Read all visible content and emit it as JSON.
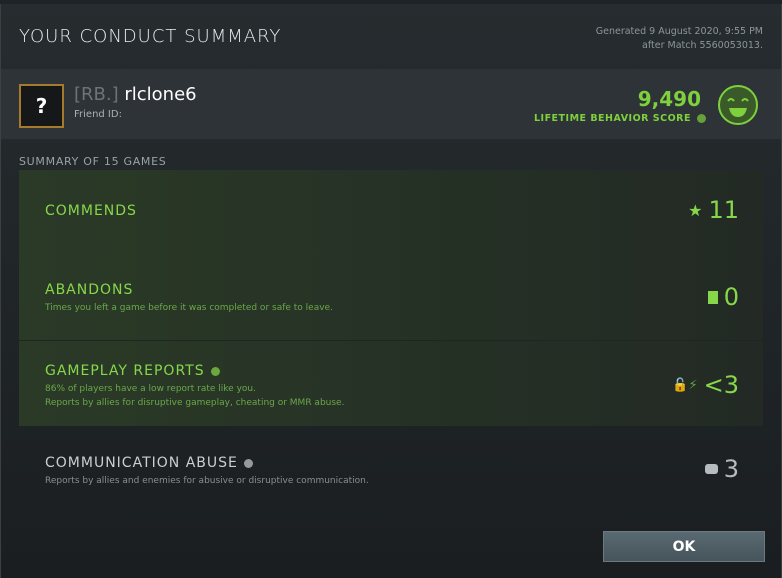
{
  "header": {
    "title": "YOUR CONDUCT SUMMARY",
    "generated": "Generated 9 August 2020, 9:55 PM",
    "after_match": "after Match 5560053013."
  },
  "profile": {
    "avatar": "?",
    "tag": "[RB.]",
    "name": "rlclone6",
    "friend_id": "Friend ID:",
    "score": "9,490",
    "score_label": "LIFETIME BEHAVIOR SCORE",
    "face_icon": "smiley-face-icon",
    "accent": "#7ed13c"
  },
  "summary_label": "SUMMARY OF 15 GAMES",
  "rows": [
    {
      "title": "COMMENDS",
      "desc": "",
      "value": "11",
      "icon": "star-plus-icon"
    },
    {
      "title": "ABANDONS",
      "desc": "Times you left a game before it was completed or safe to leave.",
      "value": "0",
      "icon": "exit-door-icon"
    },
    {
      "title": "GAMEPLAY REPORTS",
      "desc1": "86% of players have a low report rate like you.",
      "desc2": "Reports by allies for disruptive gameplay, cheating or MMR abuse.",
      "value": "<3",
      "icon": "lock-lightning-icon"
    },
    {
      "title": "COMMUNICATION ABUSE",
      "desc": "Reports by allies and enemies for abusive or disruptive communication.",
      "value": "3",
      "icon": "chat-bubble-icon"
    }
  ],
  "ok_label": "OK"
}
